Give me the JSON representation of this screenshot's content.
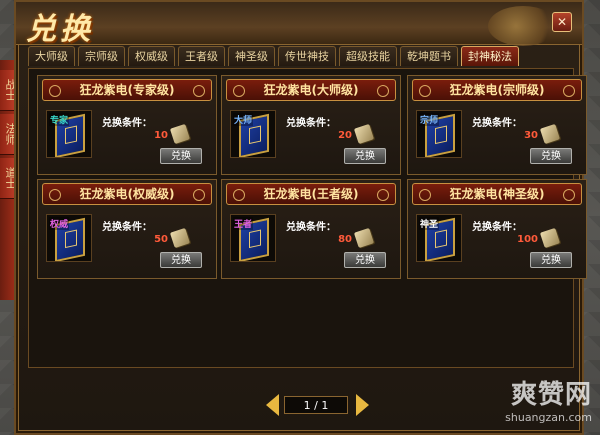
{
  "window": {
    "title": "兑换",
    "close_label": "✕"
  },
  "tabs": [
    {
      "label": "大师级",
      "active": false
    },
    {
      "label": "宗师级",
      "active": false
    },
    {
      "label": "权威级",
      "active": false
    },
    {
      "label": "王者级",
      "active": false
    },
    {
      "label": "神圣级",
      "active": false
    },
    {
      "label": "传世神技",
      "active": false
    },
    {
      "label": "超级技能",
      "active": false
    },
    {
      "label": "乾坤题书",
      "active": false
    },
    {
      "label": "封神秘法",
      "active": true
    }
  ],
  "side_tabs": [
    "战士",
    "法师",
    "道士"
  ],
  "cards": [
    {
      "title": "狂龙紫电(专家级)",
      "grade_tag": "专家",
      "tag_color": "#39d6c8",
      "condition_label": "兑换条件：",
      "count": "10",
      "button": "兑换"
    },
    {
      "title": "狂龙紫电(大师级)",
      "grade_tag": "大师",
      "tag_color": "#7ab8ff",
      "condition_label": "兑换条件：",
      "count": "20",
      "button": "兑换"
    },
    {
      "title": "狂龙紫电(宗师级)",
      "grade_tag": "宗师",
      "tag_color": "#7ab8ff",
      "condition_label": "兑换条件：",
      "count": "30",
      "button": "兑换"
    },
    {
      "title": "狂龙紫电(权威级)",
      "grade_tag": "权威",
      "tag_color": "#e060e0",
      "condition_label": "兑换条件：",
      "count": "50",
      "button": "兑换"
    },
    {
      "title": "狂龙紫电(王者级)",
      "grade_tag": "王者",
      "tag_color": "#e060e0",
      "condition_label": "兑换条件：",
      "count": "80",
      "button": "兑换"
    },
    {
      "title": "狂龙紫电(神圣级)",
      "grade_tag": "神圣",
      "tag_color": "#ffffff",
      "condition_label": "兑换条件：",
      "count": "100",
      "button": "兑换"
    }
  ],
  "pager": {
    "text": "1 / 1"
  },
  "watermark": {
    "main": "爽赞网",
    "sub": "shuangzan.com"
  }
}
